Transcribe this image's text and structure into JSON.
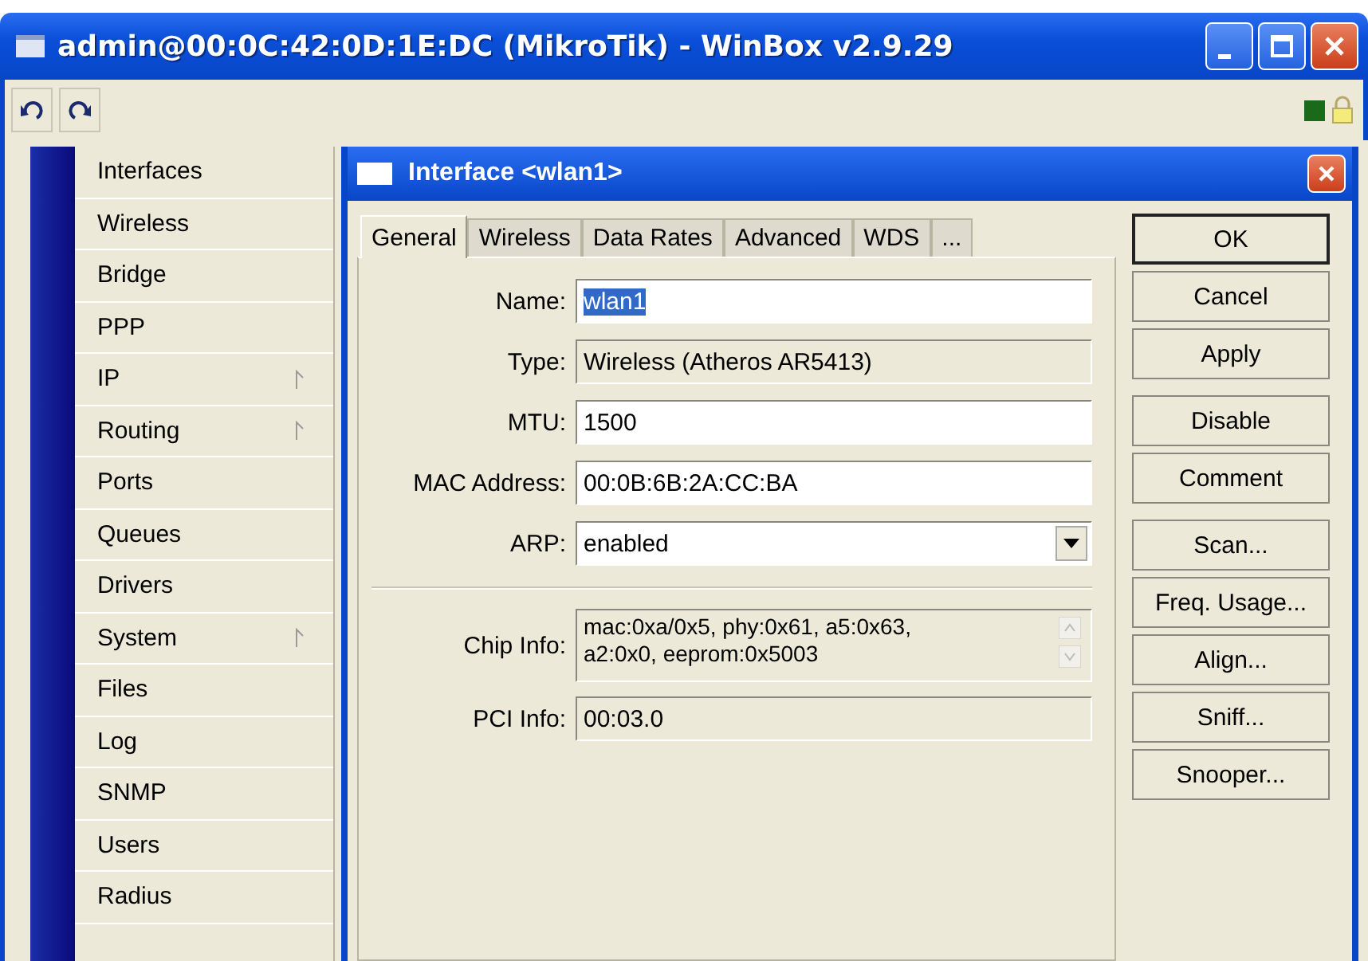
{
  "window": {
    "title": "admin@00:0C:42:0D:1E:DC (MikroTik) - WinBox v2.9.29"
  },
  "status": {
    "connected": true,
    "secure": true
  },
  "sidebar": {
    "items": [
      {
        "label": "Interfaces",
        "submenu": false
      },
      {
        "label": "Wireless",
        "submenu": false
      },
      {
        "label": "Bridge",
        "submenu": false
      },
      {
        "label": "PPP",
        "submenu": false
      },
      {
        "label": "IP",
        "submenu": true
      },
      {
        "label": "Routing",
        "submenu": true
      },
      {
        "label": "Ports",
        "submenu": false
      },
      {
        "label": "Queues",
        "submenu": false
      },
      {
        "label": "Drivers",
        "submenu": false
      },
      {
        "label": "System",
        "submenu": true
      },
      {
        "label": "Files",
        "submenu": false
      },
      {
        "label": "Log",
        "submenu": false
      },
      {
        "label": "SNMP",
        "submenu": false
      },
      {
        "label": "Users",
        "submenu": false
      },
      {
        "label": "Radius",
        "submenu": false
      }
    ]
  },
  "dialog": {
    "title": "Interface <wlan1>",
    "tabs": [
      {
        "label": "General",
        "selected": true
      },
      {
        "label": "Wireless",
        "selected": false
      },
      {
        "label": "Data Rates",
        "selected": false
      },
      {
        "label": "Advanced",
        "selected": false
      },
      {
        "label": "WDS",
        "selected": false
      },
      {
        "label": "...",
        "selected": false
      }
    ],
    "fields": [
      {
        "kind": "input",
        "label": "Name:",
        "value": "wlan1",
        "selected": true
      },
      {
        "kind": "readonly",
        "label": "Type:",
        "value": "Wireless (Atheros AR5413)"
      },
      {
        "kind": "input",
        "label": "MTU:",
        "value": "1500",
        "selected": false
      },
      {
        "kind": "input",
        "label": "MAC Address:",
        "value": "00:0B:6B:2A:CC:BA",
        "selected": false
      },
      {
        "kind": "select",
        "label": "ARP:",
        "value": "enabled"
      },
      {
        "kind": "separator"
      },
      {
        "kind": "multiline",
        "label": "Chip Info:",
        "lines": [
          "mac:0xa/0x5, phy:0x61, a5:0x63,",
          "a2:0x0, eeprom:0x5003"
        ]
      },
      {
        "kind": "readonly",
        "label": "PCI Info:",
        "value": "00:03.0"
      }
    ],
    "button_groups": [
      [
        {
          "label": "OK",
          "default": true
        },
        {
          "label": "Cancel",
          "default": false
        },
        {
          "label": "Apply",
          "default": false
        }
      ],
      [
        {
          "label": "Disable",
          "default": false
        },
        {
          "label": "Comment",
          "default": false
        }
      ],
      [
        {
          "label": "Scan...",
          "default": false
        },
        {
          "label": "Freq. Usage...",
          "default": false
        },
        {
          "label": "Align...",
          "default": false
        },
        {
          "label": "Sniff...",
          "default": false
        },
        {
          "label": "Snooper...",
          "default": false
        }
      ]
    ]
  }
}
